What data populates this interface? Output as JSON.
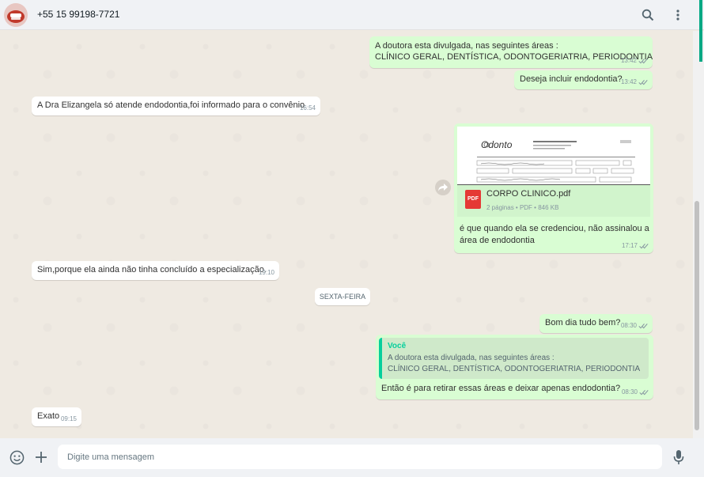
{
  "header": {
    "contact": "+55 15 99198-7721",
    "icons": [
      "avatar",
      "search-icon",
      "menu-kebab-icon"
    ]
  },
  "messages": [
    {
      "dir": "out",
      "line1": "A doutora esta divulgada, nas seguintes áreas :",
      "line2": "CLÍNICO GERAL, DENTÍSTICA, ODONTOGERIATRIA, PERIODONTIA",
      "time": "13:42",
      "status": "read"
    },
    {
      "dir": "out",
      "text": "Deseja incluir endodontia?",
      "time": "13:42",
      "status": "read"
    },
    {
      "dir": "in",
      "text": "A Dra Elizangela só atende endodontia,foi informado para o convênio",
      "time": "16:54"
    },
    {
      "dir": "out",
      "type": "document",
      "file_name": "CORPO CLINICO.pdf",
      "file_info": "2 páginas • PDF • 846 KB",
      "file_icon_label": "PDF",
      "preview_brand": "Odonto",
      "caption1": "é que quando ela se credenciou, não assinalou a",
      "caption2": "área de endodontia",
      "time": "17:17",
      "status": "read"
    },
    {
      "dir": "in",
      "text": "Sim,porque ela ainda não tinha concluído a especialização.",
      "time": "19:10"
    },
    {
      "dir": "out",
      "text": "Bom dia tudo bem?",
      "time": "08:30",
      "status": "read"
    },
    {
      "dir": "out",
      "type": "reply",
      "quote_author": "Você",
      "quote_line1": "A doutora esta divulgada, nas seguintes áreas :",
      "quote_line2": "CLÍNICO GERAL, DENTÍSTICA, ODONTOGERIATRIA, PERIODONTIA",
      "text": "Então é para retirar essas áreas e deixar apenas endodontia?",
      "time": "08:30",
      "status": "read"
    },
    {
      "dir": "in",
      "text": "Exato",
      "time": "09:15"
    }
  ],
  "day_separator": "SEXTA-FEIRA",
  "composer": {
    "placeholder": "Digite uma mensagem",
    "icons": [
      "emoji-icon",
      "attach-plus-icon",
      "microphone-icon"
    ]
  },
  "colors": {
    "outgoing_bubble": "#d9fdd3",
    "incoming_bubble": "#ffffff",
    "accent": "#06cf9c",
    "read_tick": "#8696a0",
    "pdf_red": "#e53935"
  }
}
